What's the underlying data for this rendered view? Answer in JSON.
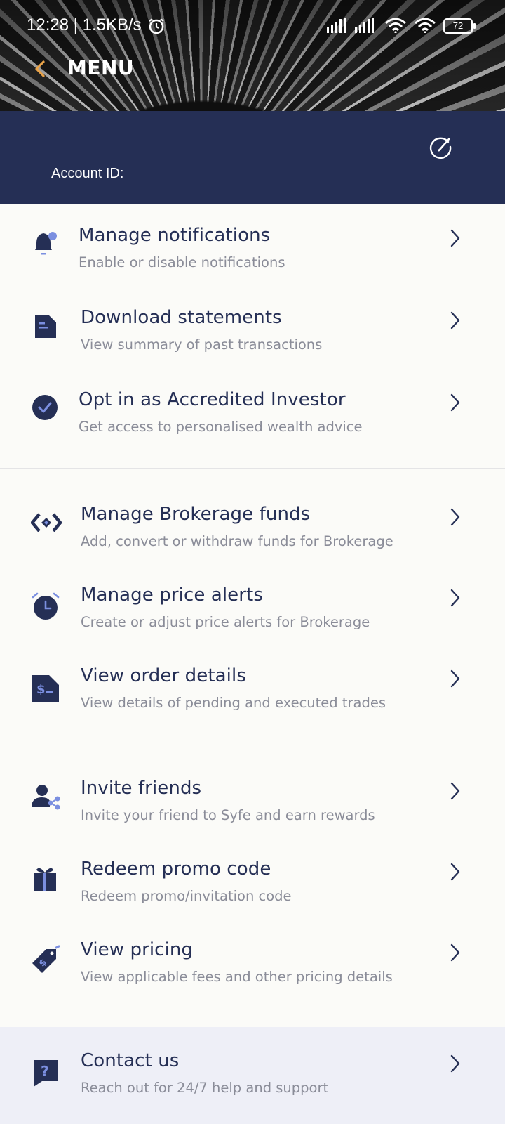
{
  "status_bar": {
    "time_speed": "12:28 | 1.5KB/s",
    "battery": "72",
    "icons": [
      "alarm-icon",
      "signal-icon",
      "signal-icon",
      "wifi-icon",
      "wifi-icon",
      "battery-icon"
    ]
  },
  "header": {
    "title": "MENU",
    "back_icon": "chevron-left-icon"
  },
  "account": {
    "id_label": "Account ID:",
    "edit_icon": "edit-icon"
  },
  "colors": {
    "navy": "#252f55",
    "accent_orange": "#e9a34a",
    "accent_blue": "#7b8fe0",
    "subtitle_gray": "#8a8c98",
    "contact_bg": "#eeeff7"
  },
  "menu": {
    "notifications": {
      "title": "Manage notifications",
      "subtitle": "Enable or disable notifications",
      "icon": "bell-icon"
    },
    "statements": {
      "title": "Download statements",
      "subtitle": "View summary of past transactions",
      "icon": "document-icon"
    },
    "accredited": {
      "title": "Opt in as Accredited Investor",
      "subtitle": "Get access to personalised wealth advice",
      "icon": "check-circle-icon"
    },
    "brokerage_funds": {
      "title": "Manage Brokerage funds",
      "subtitle": "Add, convert or withdraw funds for Brokerage",
      "icon": "transfer-icon"
    },
    "price_alerts": {
      "title": "Manage price alerts",
      "subtitle": "Create or adjust price alerts for Brokerage",
      "icon": "alarm-clock-icon"
    },
    "order_details": {
      "title": "View order details",
      "subtitle": "View details of pending and executed trades",
      "icon": "dollar-document-icon"
    },
    "invite": {
      "title": "Invite friends",
      "subtitle": "Invite your friend to Syfe and earn rewards",
      "icon": "share-user-icon"
    },
    "promo": {
      "title": "Redeem promo code",
      "subtitle": "Redeem promo/invitation code",
      "icon": "gift-icon"
    },
    "pricing": {
      "title": "View pricing",
      "subtitle": "View applicable fees and other pricing details",
      "icon": "price-tag-icon"
    },
    "contact": {
      "title": "Contact us",
      "subtitle": "Reach out for 24/7 help and support",
      "icon": "question-chat-icon"
    }
  }
}
